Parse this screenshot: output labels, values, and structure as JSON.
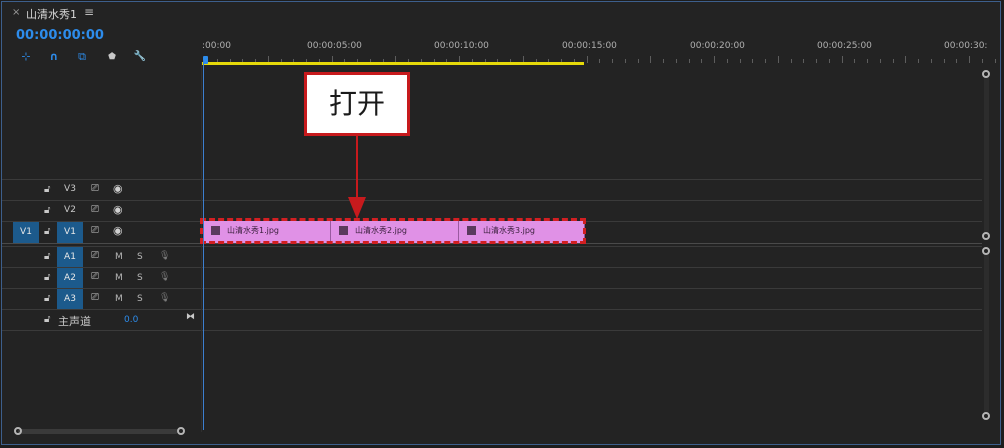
{
  "tab": {
    "close": "×",
    "title": "山清水秀1",
    "menu": "≡"
  },
  "timecode": "00:00:00:00",
  "toolbar": [
    {
      "name": "snap-icon",
      "glyph": "⊹"
    },
    {
      "name": "magnet-icon",
      "glyph": "∩"
    },
    {
      "name": "linked-selection-icon",
      "glyph": "⧉"
    },
    {
      "name": "add-marker-icon",
      "glyph": "⬟"
    },
    {
      "name": "wrench-icon",
      "glyph": "🔧"
    }
  ],
  "ruler": {
    "labels": [
      ":00:00",
      "00:00:05:00",
      "00:00:10:00",
      "00:00:15:00",
      "00:00:20:00",
      "00:00:25:00",
      "00:00:30:"
    ]
  },
  "tracks": {
    "video": [
      {
        "id": "V3",
        "source": ""
      },
      {
        "id": "V2",
        "source": ""
      },
      {
        "id": "V1",
        "source": "V1"
      }
    ],
    "audio": [
      {
        "id": "A1",
        "m": "M",
        "s": "S"
      },
      {
        "id": "A2",
        "m": "M",
        "s": "S"
      },
      {
        "id": "A3",
        "m": "M",
        "s": "S"
      }
    ],
    "master": {
      "label": "主声道",
      "value": "0.0"
    }
  },
  "clips": [
    {
      "name": "山清水秀1.jpg"
    },
    {
      "name": "山清水秀2.jpg"
    },
    {
      "name": "山清水秀3.jpg"
    }
  ],
  "callout": {
    "text": "打开"
  },
  "colors": {
    "accent": "#2d8ceb",
    "clip": "#e091e6",
    "annotation": "#d11f22",
    "workarea": "#e5d90a"
  }
}
